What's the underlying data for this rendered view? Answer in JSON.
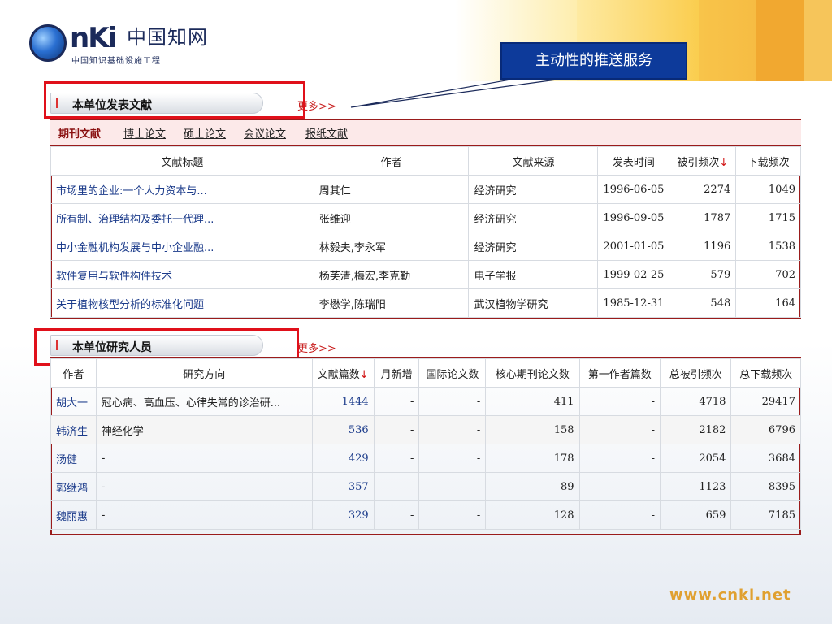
{
  "logo": {
    "letters": "nKi",
    "chinese": "中国知网",
    "subtitle": "中国知识基础设施工程"
  },
  "callout": {
    "text": "主动性的推送服务"
  },
  "publications": {
    "section_title": "本单位发表文献",
    "more": "更多>>",
    "tabs": [
      "期刊文献",
      "博士论文",
      "硕士论文",
      "会议论文",
      "报纸文献"
    ],
    "headers": [
      "文献标题",
      "作者",
      "文献来源",
      "发表时间",
      "被引频次",
      "下载频次"
    ],
    "sort_arrow": "↓",
    "rows": [
      {
        "title": "市场里的企业:一个人力资本与...",
        "author": "周其仁",
        "source": "经济研究",
        "date": "1996-06-05",
        "cited": "2274",
        "downloads": "1049"
      },
      {
        "title": "所有制、治理结构及委托一代理...",
        "author": "张维迎",
        "source": "经济研究",
        "date": "1996-09-05",
        "cited": "1787",
        "downloads": "1715"
      },
      {
        "title": "中小金融机构发展与中小企业融...",
        "author": "林毅夫,李永军",
        "source": "经济研究",
        "date": "2001-01-05",
        "cited": "1196",
        "downloads": "1538"
      },
      {
        "title": "软件复用与软件构件技术",
        "author": "杨芙清,梅宏,李克勤",
        "source": "电子学报",
        "date": "1999-02-25",
        "cited": "579",
        "downloads": "702"
      },
      {
        "title": "关于植物核型分析的标准化问题",
        "author": "李懋学,陈瑞阳",
        "source": "武汉植物学研究",
        "date": "1985-12-31",
        "cited": "548",
        "downloads": "164"
      }
    ]
  },
  "researchers": {
    "section_title": "本单位研究人员",
    "more": "更多>>",
    "headers": [
      "作者",
      "研究方向",
      "文献篇数",
      "月新增",
      "国际论文数",
      "核心期刊论文数",
      "第一作者篇数",
      "总被引频次",
      "总下载频次"
    ],
    "sort_arrow": "↓",
    "rows": [
      {
        "name": "胡大一",
        "field": "冠心病、高血压、心律失常的诊治研...",
        "papers": "1444",
        "monthly": "-",
        "intl": "-",
        "core": "411",
        "first": "-",
        "cited": "4718",
        "downloads": "29417"
      },
      {
        "name": "韩济生",
        "field": "神经化学",
        "papers": "536",
        "monthly": "-",
        "intl": "-",
        "core": "158",
        "first": "-",
        "cited": "2182",
        "downloads": "6796"
      },
      {
        "name": "汤健",
        "field": "-",
        "papers": "429",
        "monthly": "-",
        "intl": "-",
        "core": "178",
        "first": "-",
        "cited": "2054",
        "downloads": "3684"
      },
      {
        "name": "郭继鸿",
        "field": "-",
        "papers": "357",
        "monthly": "-",
        "intl": "-",
        "core": "89",
        "first": "-",
        "cited": "1123",
        "downloads": "8395"
      },
      {
        "name": "魏丽惠",
        "field": "-",
        "papers": "329",
        "monthly": "-",
        "intl": "-",
        "core": "128",
        "first": "-",
        "cited": "659",
        "downloads": "7185"
      }
    ]
  },
  "footer": {
    "url": "www.cnki.net"
  },
  "colors": {
    "accent_red": "#e0101a",
    "callout_blue": "#0d3a9a",
    "deco_orange": "#f4b23a"
  }
}
